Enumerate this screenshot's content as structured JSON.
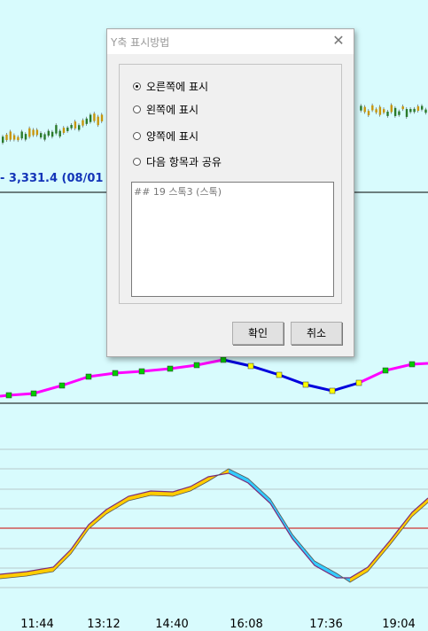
{
  "chart": {
    "price_label": "- 3,331.4 (08/01",
    "time_labels": [
      "11:44",
      "13:12",
      "14:40",
      "16:08",
      "17:36",
      "19:04"
    ],
    "colors": {
      "background": "#d8fbfd",
      "candle_up": "#c8960c",
      "candle_down": "#2a7a2a",
      "line_magenta": "#ff00ff",
      "line_blue": "#0000dd",
      "marker_green": "#00cc00",
      "marker_yellow": "#ffff00",
      "stoch_fill_up": "#ffcc00",
      "stoch_fill_down": "#33ccff",
      "grid": "#999999",
      "red_line": "#cc0000"
    }
  },
  "dialog": {
    "title": "Y축 표시방법",
    "close_icon": "close-icon",
    "options": [
      {
        "label": "오른쪽에 표시",
        "checked": true
      },
      {
        "label": "왼쪽에 표시",
        "checked": false
      },
      {
        "label": "양쪽에 표시",
        "checked": false
      },
      {
        "label": "다음 항목과 공유",
        "checked": false
      }
    ],
    "list_items": [
      "## 19 스톡3 (스톡)"
    ],
    "ok_label": "확인",
    "cancel_label": "취소"
  }
}
